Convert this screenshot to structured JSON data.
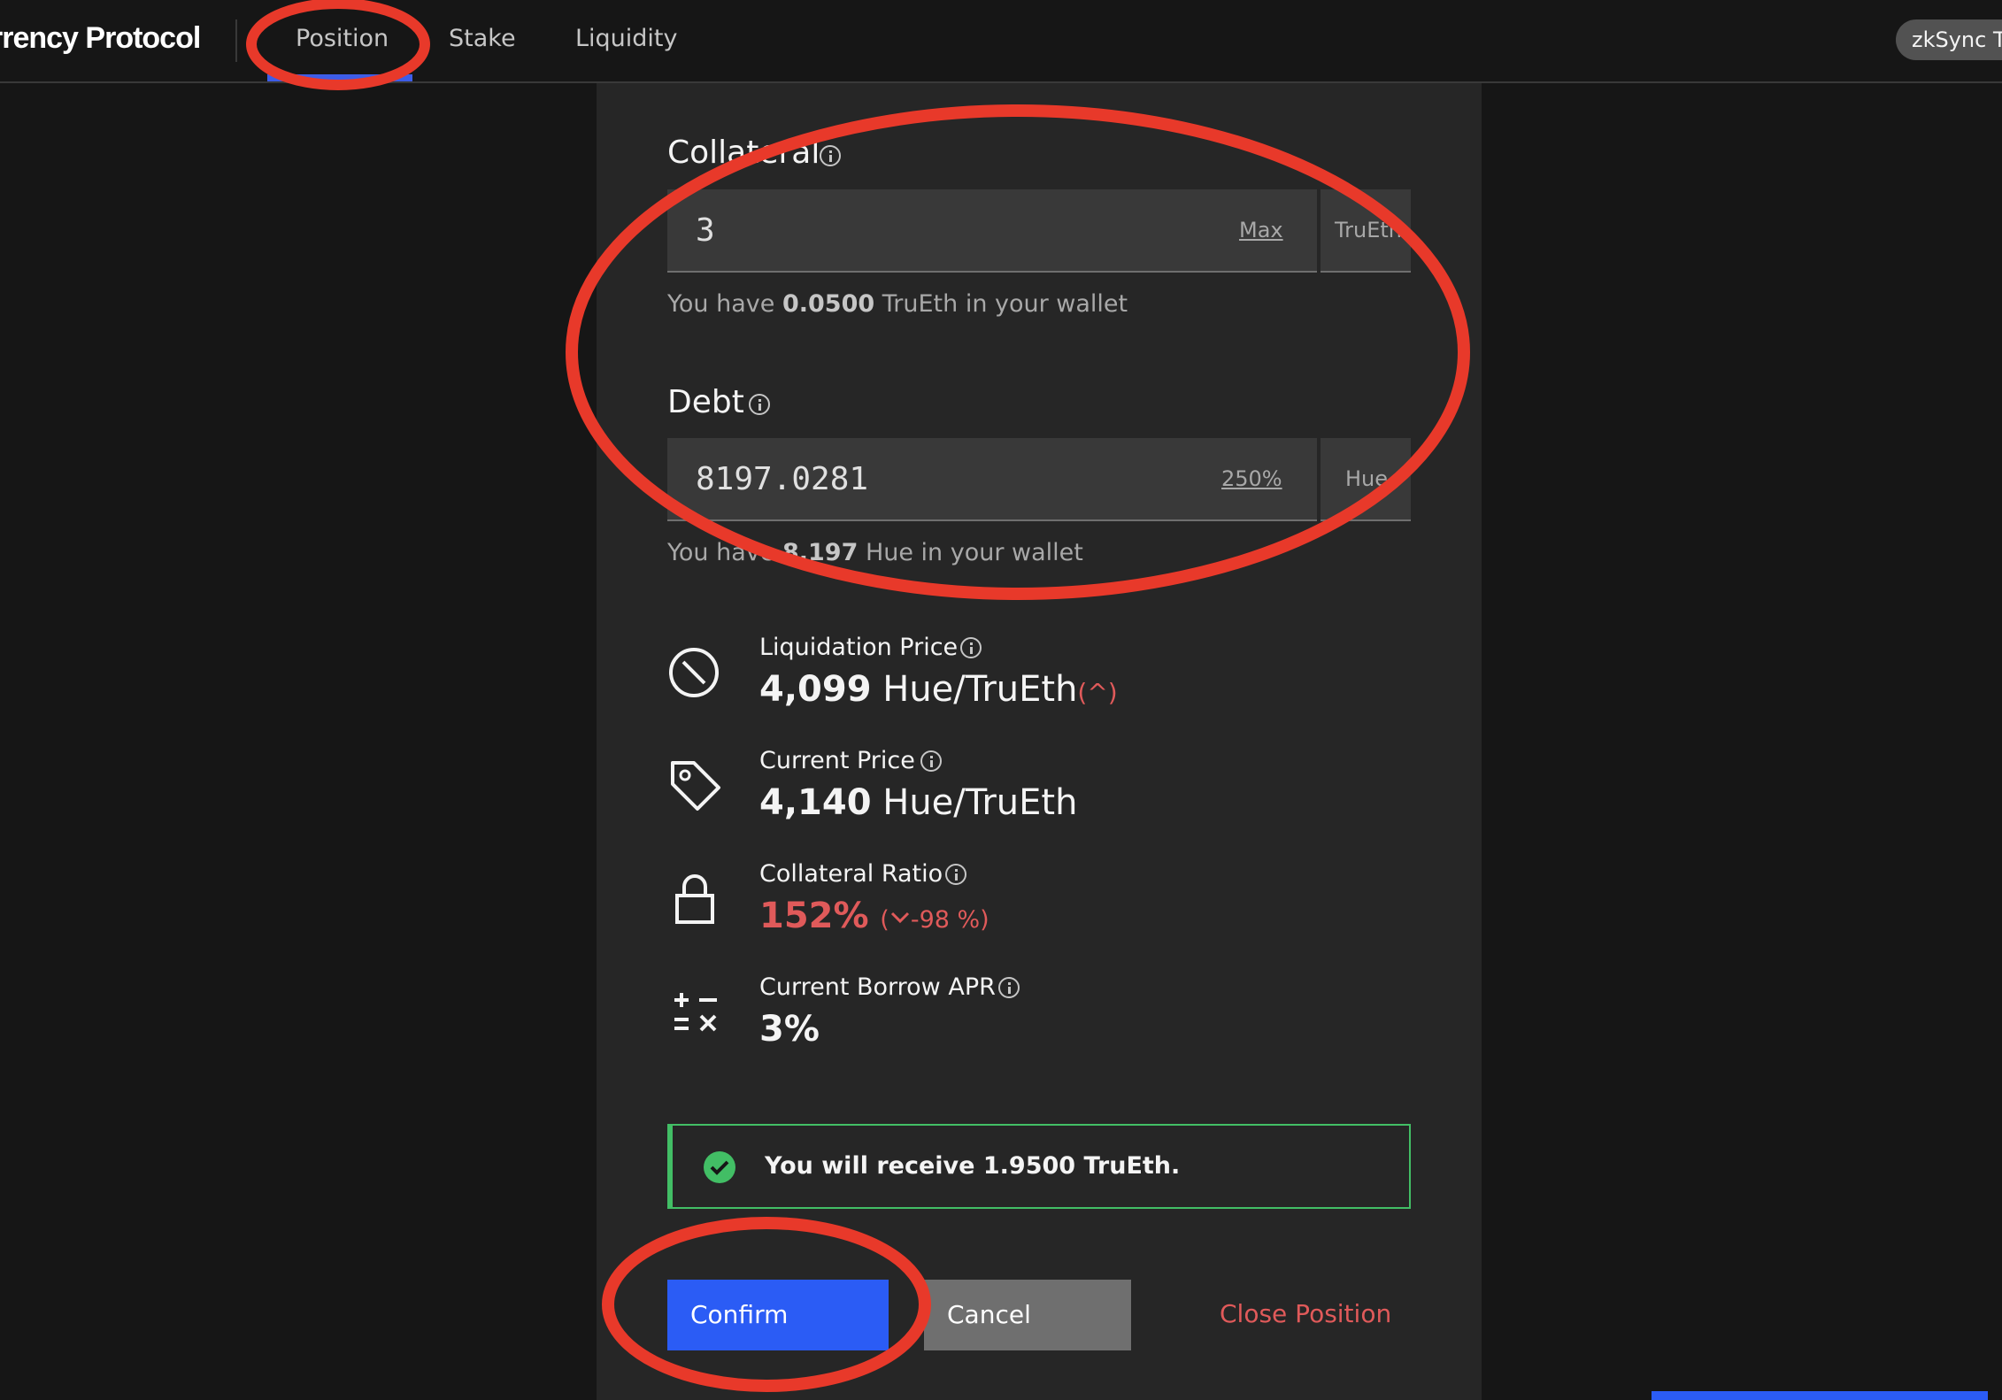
{
  "header": {
    "brand": "rrency Protocol",
    "nav": [
      {
        "label": "Position"
      },
      {
        "label": "Stake"
      },
      {
        "label": "Liquidity"
      }
    ],
    "network": "zkSync Te"
  },
  "collateral": {
    "label": "Collateral",
    "value": "3",
    "max_label": "Max",
    "unit": "TruEth",
    "helper_prefix": "You have ",
    "helper_amount": "0.0500",
    "helper_suffix": " TruEth in your wallet"
  },
  "debt": {
    "label": "Debt",
    "value": "8197.0281",
    "pct_label": "250%",
    "unit": "Hue",
    "helper_prefix": "You have ",
    "helper_amount": "8.197",
    "helper_suffix": " Hue in your wallet"
  },
  "stats": {
    "liquidation": {
      "label": "Liquidation Price",
      "value": "4,099",
      "unit": " Hue/TruEth",
      "change": "(^)"
    },
    "current": {
      "label": "Current Price",
      "value": "4,140",
      "unit": " Hue/TruEth"
    },
    "ratio": {
      "label": "Collateral Ratio",
      "value": "152%",
      "change": "-98 %)",
      "change_open": "("
    },
    "apr": {
      "label": "Current Borrow APR",
      "value": "3%"
    }
  },
  "notification": {
    "text": "You will receive 1.9500 TruEth."
  },
  "actions": {
    "confirm": "Confirm",
    "cancel": "Cancel",
    "close": "Close Position"
  },
  "colors": {
    "accent": "#2b5cf5",
    "danger": "#e05a5a",
    "success": "#42be65",
    "annotation": "#e8392a"
  }
}
